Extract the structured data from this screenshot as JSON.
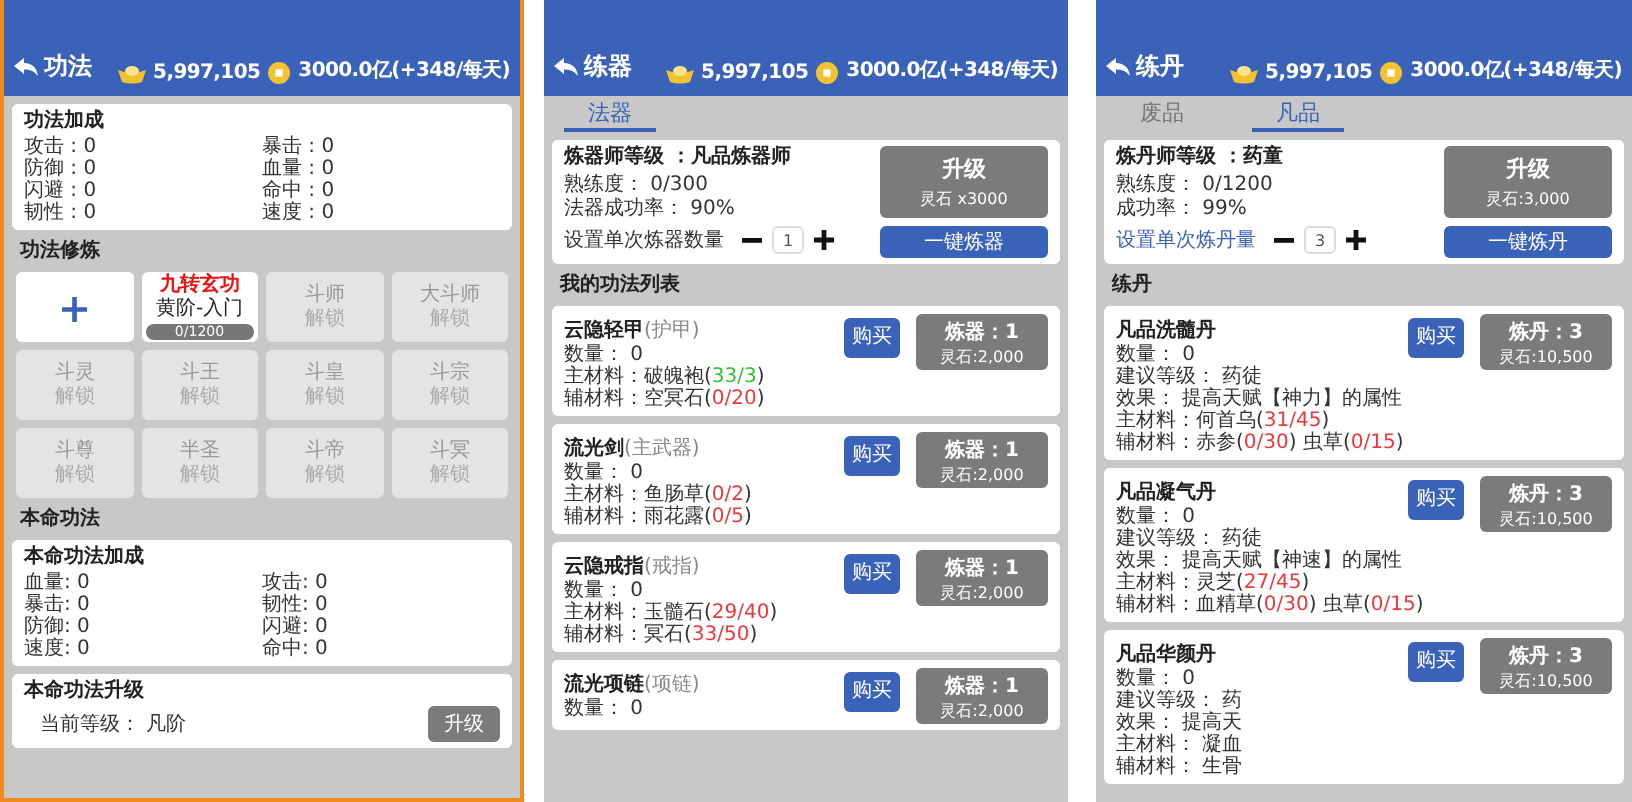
{
  "screens": [
    {
      "kind": "gongfa",
      "header": {
        "title": "功法",
        "gold": "5,997,105",
        "spirit": "3000.0亿(+348/每天)"
      },
      "bonus": {
        "title": "功法加成",
        "stats": [
          "攻击 : 0",
          "防御 : 0",
          "闪避 : 0",
          "韧性 : 0",
          "暴击 : 0",
          "血量 : 0",
          "命中 : 0",
          "速度 : 0"
        ]
      },
      "training": {
        "title": "功法修炼",
        "slots": [
          {
            "kind": "add",
            "label": "+"
          },
          {
            "kind": "active",
            "name": "九转玄功",
            "rank": "黄阶-入门",
            "progress": "0/1200"
          },
          {
            "kind": "locked",
            "name": "斗师",
            "status": "解锁"
          },
          {
            "kind": "locked",
            "name": "大斗师",
            "status": "解锁"
          },
          {
            "kind": "locked",
            "name": "斗灵",
            "status": "解锁"
          },
          {
            "kind": "locked",
            "name": "斗王",
            "status": "解锁"
          },
          {
            "kind": "locked",
            "name": "斗皇",
            "status": "解锁"
          },
          {
            "kind": "locked",
            "name": "斗宗",
            "status": "解锁"
          },
          {
            "kind": "locked",
            "name": "斗尊",
            "status": "解锁"
          },
          {
            "kind": "locked",
            "name": "半圣",
            "status": "解锁"
          },
          {
            "kind": "locked",
            "name": "斗帝",
            "status": "解锁"
          },
          {
            "kind": "locked",
            "name": "斗冥",
            "status": "解锁"
          }
        ]
      },
      "core_title": "本命功法",
      "core_bonus": {
        "title": "本命功法加成",
        "stats": [
          "血量: 0",
          "暴击: 0",
          "防御: 0",
          "速度: 0",
          "攻击: 0",
          "韧性: 0",
          "闪避: 0",
          "命中: 0"
        ]
      },
      "core_upgrade": {
        "title": "本命功法升级",
        "level_text": "当前等级： 凡阶",
        "button": "升级"
      }
    },
    {
      "kind": "forge",
      "header": {
        "title": "练器",
        "gold": "5,997,105",
        "spirit": "3000.0亿(+348/每天)"
      },
      "tabs": [
        {
          "label": "法器",
          "selected": true
        }
      ],
      "master": {
        "title": "炼器师等级 ：凡品炼器师",
        "lines": [
          "熟练度： 0/300",
          "法器成功率： 90%"
        ],
        "quantity_label": "设置单次炼器数量",
        "quantity_link": false,
        "quantity": "1",
        "upgrade": {
          "label": "升级",
          "cost": "灵石 x3000"
        },
        "action": "一键炼器"
      },
      "list_title": "我的功法列表",
      "items": [
        {
          "name": "云隐轻甲",
          "type": "(护甲)",
          "lines": [
            {
              "kind": "text",
              "text": "数量： 0"
            },
            {
              "kind": "materials",
              "label": "主材料：",
              "materials": [
                {
                  "name": "破魄袍",
                  "before": "(",
                  "count": "33/3",
                  "after": ")",
                  "enough": true
                }
              ]
            },
            {
              "kind": "materials",
              "label": "辅材料：",
              "materials": [
                {
                  "name": "空冥石",
                  "before": "(",
                  "count": "0/20",
                  "after": ")",
                  "enough": false
                }
              ]
            }
          ],
          "buy": "购买",
          "craft": {
            "label": "炼器：1",
            "cost": "灵石:2,000"
          }
        },
        {
          "name": "流光剑",
          "type": "(主武器)",
          "lines": [
            {
              "kind": "text",
              "text": "数量： 0"
            },
            {
              "kind": "materials",
              "label": "主材料：",
              "materials": [
                {
                  "name": "鱼肠草",
                  "before": "(",
                  "count": "0/2",
                  "after": ")",
                  "enough": false
                }
              ]
            },
            {
              "kind": "materials",
              "label": "辅材料：",
              "materials": [
                {
                  "name": "雨花露",
                  "before": "(",
                  "count": "0/5",
                  "after": ")",
                  "enough": false
                }
              ]
            }
          ],
          "buy": "购买",
          "craft": {
            "label": "炼器：1",
            "cost": "灵石:2,000"
          }
        },
        {
          "name": "云隐戒指",
          "type": "(戒指)",
          "lines": [
            {
              "kind": "text",
              "text": "数量： 0"
            },
            {
              "kind": "materials",
              "label": "主材料：",
              "materials": [
                {
                  "name": "玉髓石",
                  "before": "(",
                  "count": "29/40",
                  "after": ")",
                  "enough": false
                }
              ]
            },
            {
              "kind": "materials",
              "label": "辅材料：",
              "materials": [
                {
                  "name": "冥石",
                  "before": "(",
                  "count": "33/50",
                  "after": ")",
                  "enough": false
                }
              ]
            }
          ],
          "buy": "购买",
          "craft": {
            "label": "炼器：1",
            "cost": "灵石:2,000"
          }
        },
        {
          "name": "流光项链",
          "type": "(项链)",
          "lines": [
            {
              "kind": "text",
              "text": "数量： 0"
            }
          ],
          "buy": "购买",
          "craft": {
            "label": "炼器：1",
            "cost": "灵石:2,000"
          }
        }
      ]
    },
    {
      "kind": "alchemy",
      "header": {
        "title": "练丹",
        "gold": "5,997,105",
        "spirit": "3000.0亿(+348/每天)"
      },
      "tabs": [
        {
          "label": "废品",
          "selected": false
        },
        {
          "label": "凡品",
          "selected": true
        }
      ],
      "master": {
        "title": "炼丹师等级 ：药童",
        "lines": [
          "熟练度： 0/1200",
          "成功率： 99%"
        ],
        "quantity_label": "设置单次炼丹量",
        "quantity_link": true,
        "quantity": "3",
        "upgrade": {
          "label": "升级",
          "cost": "灵石:3,000"
        },
        "action": "一键炼丹"
      },
      "list_title": "练丹",
      "items": [
        {
          "name": "凡品洗髓丹",
          "lines": [
            {
              "kind": "text",
              "text": "数量： 0"
            },
            {
              "kind": "text",
              "text": "建议等级： 药徒"
            },
            {
              "kind": "text",
              "text": "效果： 提高天赋【神力】的属性"
            },
            {
              "kind": "materials",
              "label": "主材料：",
              "materials": [
                {
                  "name": "何首乌",
                  "before": "(",
                  "count": "31/45",
                  "after": ")",
                  "enough": false
                }
              ]
            },
            {
              "kind": "materials",
              "label": "辅材料：",
              "materials": [
                {
                  "name": "赤参",
                  "before": "(",
                  "count": "0/30",
                  "after": ")",
                  "enough": false
                },
                {
                  "name": "虫草",
                  "before": "(",
                  "count": "0/15",
                  "after": ")",
                  "enough": false
                }
              ]
            }
          ],
          "buy": "购买",
          "craft": {
            "label": "炼丹：3",
            "cost": "灵石:10,500"
          }
        },
        {
          "name": "凡品凝气丹",
          "lines": [
            {
              "kind": "text",
              "text": "数量： 0"
            },
            {
              "kind": "text",
              "text": "建议等级： 药徒"
            },
            {
              "kind": "text",
              "text": "效果： 提高天赋【神速】的属性"
            },
            {
              "kind": "materials",
              "label": "主材料：",
              "materials": [
                {
                  "name": "灵芝",
                  "before": "(",
                  "count": "27/45",
                  "after": ")",
                  "enough": false
                }
              ]
            },
            {
              "kind": "materials",
              "label": "辅材料：",
              "materials": [
                {
                  "name": "血精草",
                  "before": "(",
                  "count": "0/30",
                  "after": ")",
                  "enough": false
                },
                {
                  "name": "虫草",
                  "before": "(",
                  "count": "0/15",
                  "after": ")",
                  "enough": false
                }
              ]
            }
          ],
          "buy": "购买",
          "craft": {
            "label": "炼丹：3",
            "cost": "灵石:10,500"
          }
        },
        {
          "name": "凡品华颜丹",
          "lines": [
            {
              "kind": "text",
              "text": "数量： 0"
            },
            {
              "kind": "text",
              "text": "建议等级： 药"
            },
            {
              "kind": "text",
              "text": "效果： 提高天"
            },
            {
              "kind": "text",
              "text": "主材料： 凝血"
            },
            {
              "kind": "text",
              "text": "辅材料： 生骨"
            }
          ],
          "buy": "购买",
          "craft": {
            "label": "炼丹：3",
            "cost": "灵石:10,500"
          }
        }
      ]
    }
  ]
}
